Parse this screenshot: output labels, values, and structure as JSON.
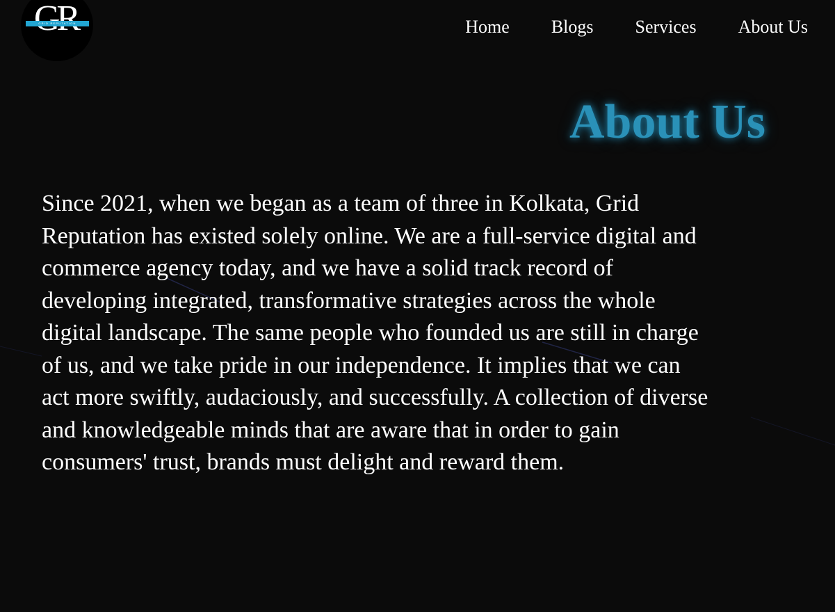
{
  "brand": {
    "logo_letters": "GR",
    "logo_tagline": "GRID REPUTATION",
    "colors": {
      "background": "#0b0b0b",
      "accent": "#2a91b8",
      "logo_band": "#22a5d2",
      "text": "#ffffff"
    }
  },
  "nav": {
    "items": [
      {
        "label": "Home"
      },
      {
        "label": "Blogs"
      },
      {
        "label": "Services"
      },
      {
        "label": "About Us"
      }
    ]
  },
  "main": {
    "title": "About Us",
    "body": "Since 2021, when we began as a team of three in Kolkata, Grid Reputation has existed solely online. We are a full-service digital and commerce agency today, and we have a solid track record of developing integrated, transformative strategies across the whole digital landscape. The same people who founded us are still in charge of us, and we take pride in our independence. It implies that we can act more swiftly, audaciously, and successfully. A collection of diverse and knowledgeable minds that are aware that in order to gain consumers' trust, brands must delight and reward them."
  }
}
